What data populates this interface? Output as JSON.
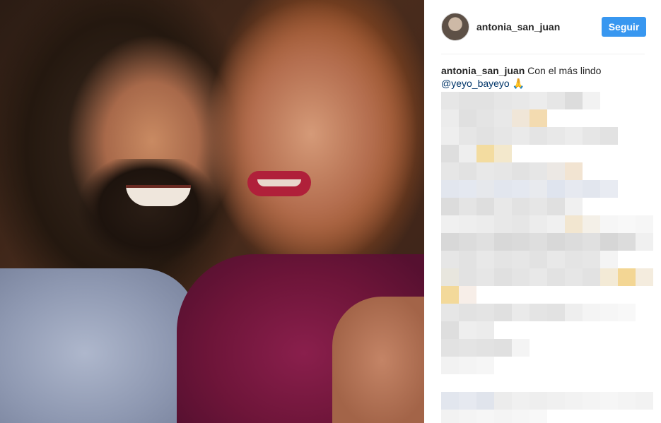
{
  "post": {
    "username": "antonia_san_juan",
    "follow_label": "Seguir",
    "caption": {
      "username": "antonia_san_juan",
      "text": "Con el más lindo",
      "mention": "@yeyo_bayeyo",
      "emoji": "🙏"
    }
  },
  "colors": {
    "follow_button": "#3897f0",
    "mention_link": "#003569",
    "text": "#262626"
  },
  "blurred_comments": {
    "rows": [
      [
        "#e6e6e6",
        "#e2e2e2",
        "#e2e2e2",
        "#e6e6e6",
        "#e8e8e8",
        "#ececec",
        "#e6e6e6",
        "#dcdcdc",
        "#f2f2f2"
      ],
      [
        "#ececec",
        "#e0e0e0",
        "#e4e4e4",
        "#e8e8e8",
        "#f0e6d8",
        "#f3dbb0"
      ],
      [
        "#eeeeee",
        "#e6e6e6",
        "#e2e2e2",
        "#e6e6e6",
        "#eaeaea",
        "#e4e4e4",
        "#e8e8e8",
        "#ececec",
        "#e6e6e6",
        "#e2e2e2"
      ],
      [
        "#dedede",
        "#eeeeee",
        "#f3dca0",
        "#f3e8cc"
      ],
      [
        "#e6e6e6",
        "#e2e2e2",
        "#e8e8e8",
        "#e6e6e6",
        "#e2e2e2",
        "#e6e6e6",
        "#ece8e4",
        "#f2e4d2"
      ],
      [
        "#e2e6ee",
        "#e4e8f0",
        "#e6e8ec",
        "#e2e6ee",
        "#e4e8f0",
        "#e8eaee",
        "#dfe4ee",
        "#e6e9f0",
        "#e2e6ee",
        "#e8ebf2"
      ],
      [
        "#dcdcdc",
        "#e4e4e4",
        "#dedede",
        "#e8e8e8",
        "#e2e2e2",
        "#e6e6e6",
        "#e0e0e0",
        "#f0f0f0"
      ],
      [
        "#f0f0f0",
        "#eeeeee",
        "#ececec",
        "#e8e8e8",
        "#e6e6e6",
        "#ececec",
        "#f0f0f0",
        "#f2e6d0",
        "#f4f0e8",
        "#f6f6f6",
        "#f8f8f8",
        "#f6f6f6"
      ],
      [
        "#d8d8d8",
        "#dcdcdc",
        "#e0e0e0",
        "#d8d8d8",
        "#dadada",
        "#dedede",
        "#d8d8d8",
        "#dcdcdc",
        "#e0e0e0",
        "#d6d6d6",
        "#dcdcdc",
        "#f0f0f0"
      ],
      [
        "#e6e6e6",
        "#e2e2e2",
        "#e8e8e8",
        "#e4e4e4",
        "#e6e6e6",
        "#e2e2e2",
        "#e8e8e8",
        "#e4e4e4",
        "#e6e6e6",
        "#f4f4f4"
      ],
      [
        "#e8e6de",
        "#e2e2e2",
        "#e6e6e6",
        "#e0e0e0",
        "#e4e4e4",
        "#e8e8e8",
        "#e2e2e2",
        "#e6e6e6",
        "#e2e2e2",
        "#f3ead6",
        "#f3d694",
        "#f4ecde"
      ],
      [
        "#f3d99a",
        "#f7eee8"
      ],
      [
        "#e6e6e6",
        "#e2e2e2",
        "#e4e4e4",
        "#e0e0e0",
        "#eaeaea",
        "#e4e4e4",
        "#e2e2e2",
        "#eeeeee",
        "#f4f4f4",
        "#f6f6f6",
        "#f8f8f8"
      ],
      [
        "#dedede",
        "#eeeeee",
        "#ececec"
      ],
      [
        "#e2e2e2",
        "#e4e4e4",
        "#e2e2e2",
        "#e0e0e0",
        "#f4f4f4"
      ],
      [
        "#f2f2f2",
        "#f4f4f4",
        "#f6f6f6"
      ],
      [],
      [
        "#e2e6ee",
        "#e6e9f0",
        "#e0e4ec",
        "#ececec",
        "#f0f0f0",
        "#eeeeee",
        "#f0f0f0",
        "#f2f2f2",
        "#f4f4f4",
        "#f6f6f6",
        "#f4f4f4",
        "#f2f2f2"
      ],
      [
        "#f2f2f2",
        "#f4f4f4",
        "#f6f6f6",
        "#f4f4f4",
        "#f6f6f6",
        "#f8f8f8"
      ]
    ]
  }
}
